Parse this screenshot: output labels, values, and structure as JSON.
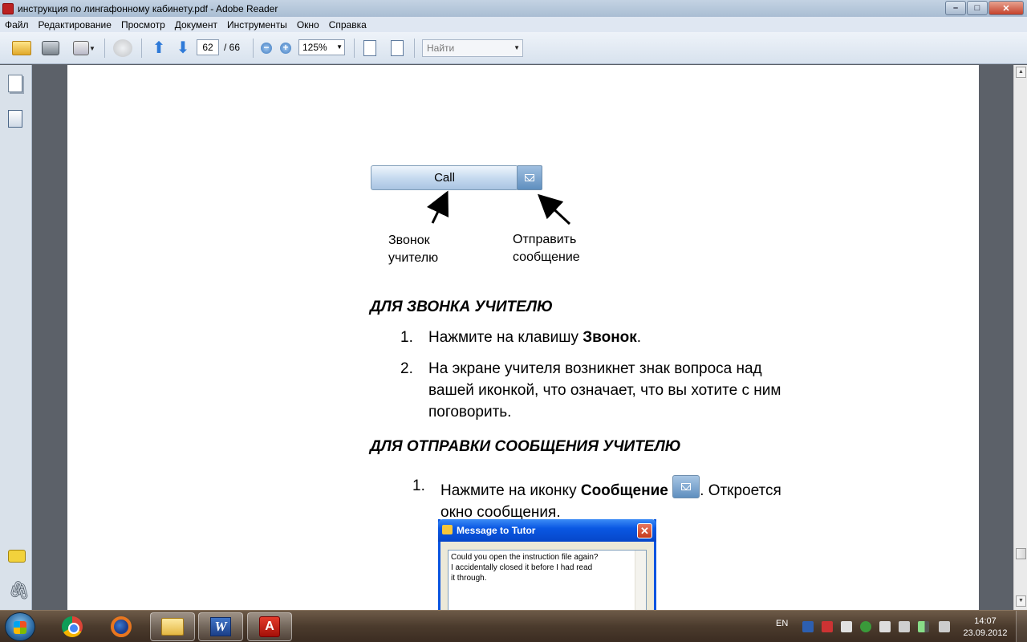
{
  "window": {
    "title": "инструкция по лингафонному кабинету.pdf - Adobe Reader",
    "minimize_label": "–",
    "maximize_label": "□",
    "close_label": "✕"
  },
  "menu": [
    "Файл",
    "Редактирование",
    "Просмотр",
    "Документ",
    "Инструменты",
    "Окно",
    "Справка"
  ],
  "toolbar": {
    "page_current": "62",
    "page_total": "/ 66",
    "zoom": "125%",
    "find_placeholder": "Найти",
    "zoom_out_symbol": "−",
    "zoom_in_symbol": "+",
    "prev_page_symbol": "⬆",
    "next_page_symbol": "⬇",
    "dropdown_symbol": "▼"
  },
  "document": {
    "call_button_label": "Call",
    "caption_call": [
      "Звонок",
      "учителю"
    ],
    "caption_message": [
      "Отправить",
      "сообщение"
    ],
    "heading_call": "ДЛЯ ЗВОНКА УЧИТЕЛЮ",
    "call_steps": [
      {
        "num": "1.",
        "pre": "Нажмите на клавишу ",
        "bold": "Звонок",
        "post": "."
      },
      {
        "num": "2.",
        "lines": [
          "На экране учителя возникнет знак вопроса над",
          "вашей иконкой, что означает, что вы хотите с ним",
          "поговорить."
        ]
      }
    ],
    "heading_message": "ДЛЯ ОТПРАВКИ СООБЩЕНИЯ УЧИТЕЛЮ",
    "message_step": {
      "num": "1.",
      "pre": "Нажмите на иконку ",
      "bold": "Сообщение",
      "post": ". Откроется",
      "line2": "окно сообщения."
    },
    "dialog": {
      "title": "Message to Tutor",
      "close_symbol": "✕",
      "text_lines": [
        "Could you open the instruction file again?",
        "I accidentally closed it before I had read",
        "it through."
      ]
    }
  },
  "scrollbar": {
    "up_symbol": "▲",
    "down_symbol": "▼"
  },
  "taskbar": {
    "language": "EN",
    "time": "14:07",
    "date": "23.09.2012",
    "word_letter": "W",
    "acrobat_letter": "A"
  },
  "colors": {
    "titlebar": "#a9bdd3",
    "menubar": "#dfe7f2",
    "document_background": "#5c6169",
    "taskbar": "#4b3b2d",
    "dialog_titlebar": "#0a58e3"
  }
}
